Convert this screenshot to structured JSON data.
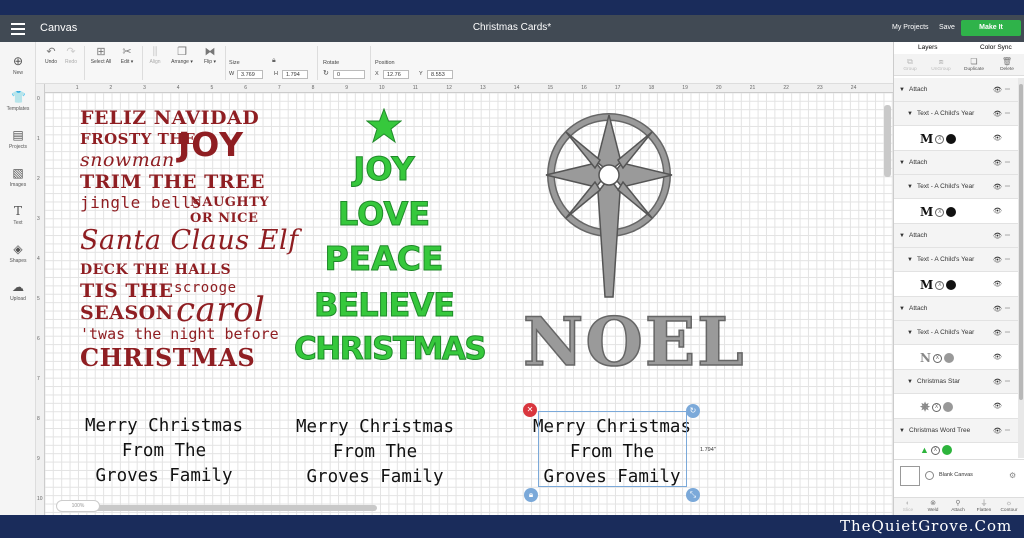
{
  "header": {
    "app_title": "Canvas",
    "doc_title": "Christmas Cards*",
    "my_projects": "My Projects",
    "save": "Save",
    "make_it": "Make It"
  },
  "left_toolbar": [
    {
      "label": "New",
      "icon": "plus-circle-icon"
    },
    {
      "label": "Templates",
      "icon": "shirt-icon"
    },
    {
      "label": "Projects",
      "icon": "projects-icon"
    },
    {
      "label": "Images",
      "icon": "image-icon"
    },
    {
      "label": "Text",
      "icon": "text-icon"
    },
    {
      "label": "Shapes",
      "icon": "shapes-icon"
    },
    {
      "label": "Upload",
      "icon": "upload-icon"
    }
  ],
  "toolbar": {
    "undo": "Undo",
    "redo": "Redo",
    "select_all": "Select All",
    "edit": "Edit",
    "align": "Align",
    "arrange": "Arrange",
    "flip": "Flip",
    "size_label": "Size",
    "w_label": "W",
    "w_value": "3.769",
    "h_label": "H",
    "h_value": "1.794",
    "rotate_label": "Rotate",
    "rotate_value": "0",
    "position_label": "Position",
    "x_label": "X",
    "x_value": "12.76",
    "y_label": "Y",
    "y_value": "8.553"
  },
  "ruler": {
    "h": [
      "0",
      "1",
      "2",
      "3",
      "4",
      "5",
      "6",
      "7",
      "8",
      "9",
      "10",
      "11",
      "12",
      "13",
      "14",
      "15",
      "16",
      "17",
      "18",
      "19",
      "20",
      "21",
      "22",
      "23",
      "24"
    ],
    "v": [
      "0",
      "1",
      "2",
      "3",
      "4",
      "5",
      "6",
      "7",
      "8",
      "9",
      "10"
    ]
  },
  "zoom": "100%",
  "canvas": {
    "subway_lines": [
      "FELIZ NAVIDAD",
      "FROSTY THE JOY",
      "snowman JOY",
      "TRIM THE TREE",
      "jingle bells NAUGHTY",
      "OR NICE",
      "Santa Claus Elf",
      "DECK THE HALLS",
      "TIS THE scrooge",
      "SEASON carol",
      "'twas the night before",
      "CHRISTMAS"
    ],
    "tree_words": [
      "JOY",
      "LOVE",
      "PEACE",
      "BELIEVE",
      "CHRISTMAS"
    ],
    "noel": "NOEL",
    "greeting_1": "Merry Christmas",
    "greeting_2": "From The",
    "greeting_3": "Groves Family",
    "height_readout": "1.794\""
  },
  "right_panel": {
    "tab_layers": "Layers",
    "tab_color_sync": "Color Sync",
    "actions": [
      "Group",
      "UnGroup",
      "Duplicate",
      "Delete"
    ],
    "layers": [
      {
        "type": "group",
        "name": "Attach"
      },
      {
        "type": "sub",
        "name": "Text - A Child's Year"
      },
      {
        "type": "thumb",
        "glyph": "M"
      },
      {
        "type": "group",
        "name": "Attach"
      },
      {
        "type": "sub",
        "name": "Text - A Child's Year"
      },
      {
        "type": "thumb",
        "glyph": "M"
      },
      {
        "type": "group",
        "name": "Attach"
      },
      {
        "type": "sub",
        "name": "Text - A Child's Year"
      },
      {
        "type": "thumb",
        "glyph": "M"
      },
      {
        "type": "group",
        "name": "Attach"
      },
      {
        "type": "sub",
        "name": "Text - A Child's Year"
      },
      {
        "type": "thumb",
        "glyph": "N"
      },
      {
        "type": "sub",
        "name": "Christmas Star"
      },
      {
        "type": "thumb",
        "glyph": "✵"
      },
      {
        "type": "group",
        "name": "Christmas Word Tree"
      }
    ],
    "blank_canvas": "Blank Canvas",
    "bottom": [
      "Slice",
      "Weld",
      "Attach",
      "Flatten",
      "Contour"
    ]
  },
  "colors": {
    "subway_red": "#8f1e22",
    "tree_green": "#36c83c",
    "noel_gray": "#9a9a9a",
    "make_it": "#2fb34a",
    "frame_navy": "#1a2c5b"
  },
  "footer_brand": "TheQuietGrove.Com"
}
